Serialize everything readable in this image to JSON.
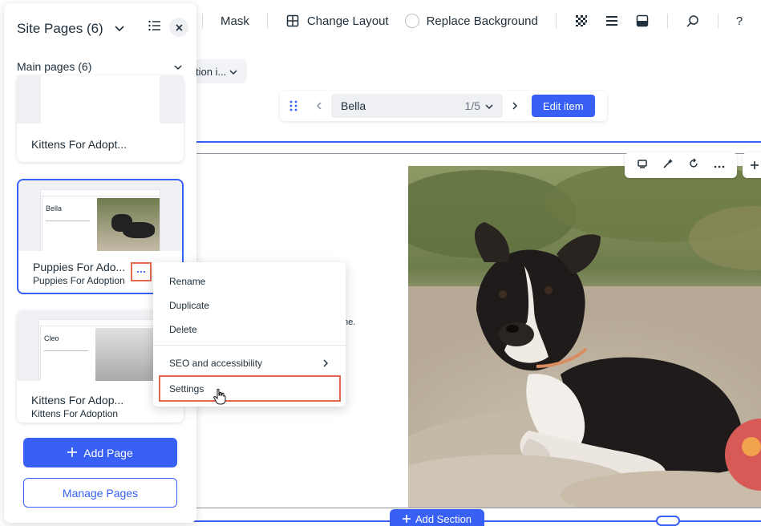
{
  "toolbar": {
    "mask_label": "Mask",
    "change_layout_label": "Change Layout",
    "replace_background_label": "Replace Background",
    "help_label": "?"
  },
  "chip": {
    "label": "tion i..."
  },
  "collection_nav": {
    "item_name": "Bella",
    "item_count": "1/5",
    "edit_label": "Edit item"
  },
  "canvas": {
    "partial_text": "ne."
  },
  "add_section_label": "Add Section",
  "panel": {
    "title": "Site Pages (6)",
    "subheader": "Main pages (6)",
    "cards": [
      {
        "name": "Kittens For Adopt...",
        "sub": ""
      },
      {
        "name": "Puppies For Ado...",
        "sub": "Puppies For Adoption",
        "preview_title": "Bella"
      },
      {
        "name": "Kittens For Adop...",
        "sub": "Kittens For Adoption",
        "preview_title": "Cleo"
      }
    ],
    "add_page_label": "Add Page",
    "manage_pages_label": "Manage Pages"
  },
  "context_menu": {
    "rename": "Rename",
    "duplicate": "Duplicate",
    "delete": "Delete",
    "seo": "SEO and accessibility",
    "settings": "Settings"
  },
  "colors": {
    "accent": "#3860f5",
    "highlight": "#e4684e"
  }
}
